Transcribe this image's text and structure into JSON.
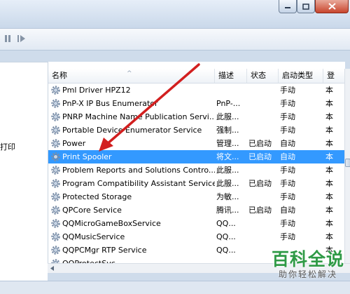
{
  "left_pane": {
    "description_fragment": "打印"
  },
  "columns": {
    "name": "名称",
    "desc": "描述",
    "status": "状态",
    "startup": "启动类型",
    "logon": "登"
  },
  "services": [
    {
      "name": "Pml Driver HPZ12",
      "desc": "",
      "status": "",
      "startup": "手动",
      "logon": "本"
    },
    {
      "name": "PnP-X IP Bus Enumerator",
      "desc": "PnP-...",
      "status": "",
      "startup": "手动",
      "logon": "本"
    },
    {
      "name": "PNRP Machine Name Publication Servi...",
      "desc": "此服...",
      "status": "",
      "startup": "手动",
      "logon": "本"
    },
    {
      "name": "Portable Device Enumerator Service",
      "desc": "强制...",
      "status": "",
      "startup": "手动",
      "logon": "本"
    },
    {
      "name": "Power",
      "desc": "管理...",
      "status": "已启动",
      "startup": "自动",
      "logon": "本"
    },
    {
      "name": "Print Spooler",
      "desc": "将文...",
      "status": "已启动",
      "startup": "自动",
      "logon": "本",
      "selected": true
    },
    {
      "name": "Problem Reports and Solutions Contro...",
      "desc": "此服...",
      "status": "",
      "startup": "手动",
      "logon": "本"
    },
    {
      "name": "Program Compatibility Assistant Service",
      "desc": "此服...",
      "status": "已启动",
      "startup": "手动",
      "logon": "本"
    },
    {
      "name": "Protected Storage",
      "desc": "为敏...",
      "status": "",
      "startup": "手动",
      "logon": "本"
    },
    {
      "name": "QPCore Service",
      "desc": "腾讯...",
      "status": "已启动",
      "startup": "自动",
      "logon": "本"
    },
    {
      "name": "QQMicroGameBoxService",
      "desc": "QQ...",
      "status": "",
      "startup": "手动",
      "logon": "本"
    },
    {
      "name": "QQMusicService",
      "desc": "QQ...",
      "status": "",
      "startup": "手动",
      "logon": "本"
    },
    {
      "name": "QQPCMgr RTP Service",
      "desc": "QQ...",
      "status": "",
      "startup": "",
      "logon": "本"
    },
    {
      "name": "QQProtectSvc",
      "desc": "",
      "status": "",
      "startup": "",
      "logon": ""
    }
  ],
  "watermark": {
    "main": "百科全说",
    "sub": "助你轻松解决"
  },
  "colors": {
    "selection": "#3399ff",
    "arrow": "#d21f1f",
    "watermark": "#2f9a46"
  }
}
